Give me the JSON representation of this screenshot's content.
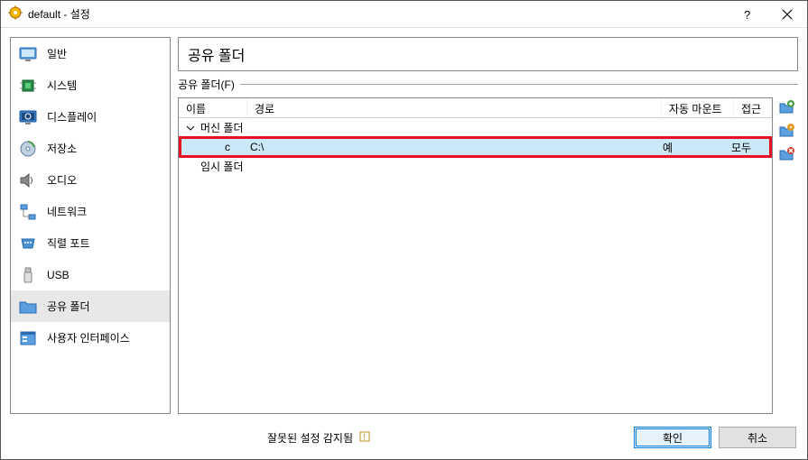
{
  "title": "default - 설정",
  "sidebar": {
    "items": [
      {
        "label": "일반"
      },
      {
        "label": "시스템"
      },
      {
        "label": "디스플레이"
      },
      {
        "label": "저장소"
      },
      {
        "label": "오디오"
      },
      {
        "label": "네트워크"
      },
      {
        "label": "직렬 포트"
      },
      {
        "label": "USB"
      },
      {
        "label": "공유 폴더"
      },
      {
        "label": "사용자 인터페이스"
      }
    ]
  },
  "main": {
    "header": "공유 폴더",
    "group_label": "공유 폴더(F)",
    "columns": {
      "name": "이름",
      "path": "경로",
      "auto": "자동 마운트",
      "access": "접근"
    },
    "tree": {
      "machine_folders": "머신 폴더",
      "temp_folders": "임시 폴더"
    },
    "rows": [
      {
        "name": "c",
        "path": "C:\\",
        "auto": "예",
        "access": "모두"
      }
    ]
  },
  "footer": {
    "status": "잘못된 설정 감지됨",
    "ok": "확인",
    "cancel": "취소"
  }
}
